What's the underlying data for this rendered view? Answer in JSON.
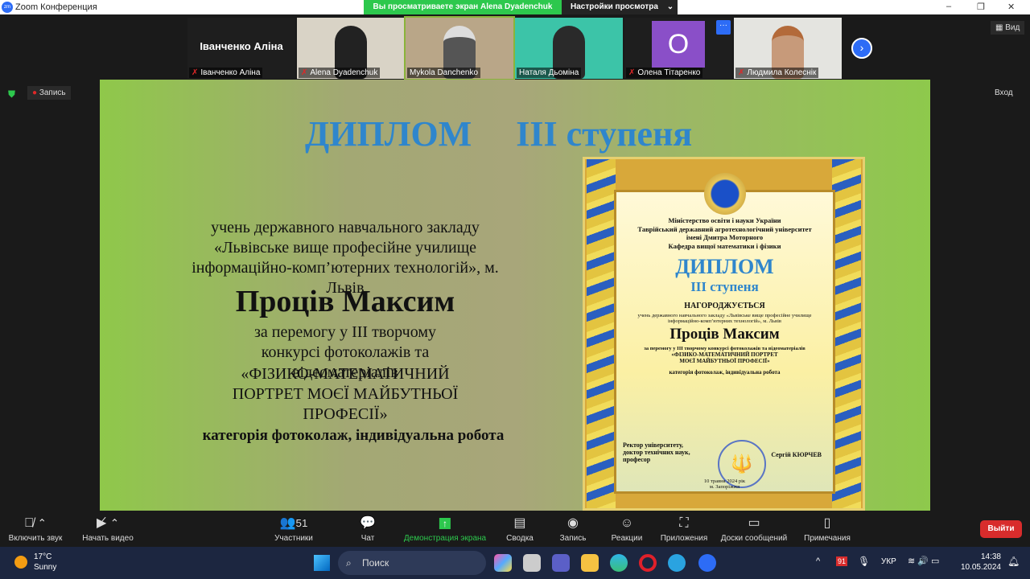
{
  "titlebar": {
    "title": "Zoom Конференция",
    "banner": "Вы просматриваете экран Alena Dyadenchuk",
    "view_settings": "Настройки просмотра"
  },
  "participants": [
    {
      "name": "Іванченко Аліна",
      "big_name": "Іванченко Аліна",
      "muted": true
    },
    {
      "name": "Alena Dyadenchuk",
      "muted": true
    },
    {
      "name": "Mykola Danchenko",
      "muted": false
    },
    {
      "name": "Наталя Дьоміна",
      "muted": false
    },
    {
      "name": "Олена Тітаренко",
      "muted": true,
      "initial": "О"
    },
    {
      "name": "Людмила Колеснік",
      "muted": true
    }
  ],
  "view_label": "Вид",
  "record_label": "Запись",
  "exit_top": "Вход",
  "slide": {
    "title": "ДИПЛОМ     ІІІ ступеня",
    "school": "учень державного навчального закладу «Львівське вище професійне училище інформаційно-комп’ютерних технологій», м. Львів",
    "name": "Проців Максим",
    "reason": "за перемогу у ІІІ творчому конкурсі фотоколажів та відеоматеріалів",
    "contest": "«ФІЗИКО-МАТЕМАТИЧНИЙ ПОРТРЕТ МОЄЇ МАЙБУТНЬОЇ ПРОФЕСІЇ»",
    "category": "категорія фотоколаж, індивідуальна робота"
  },
  "diploma": {
    "header": "Міністерство освіти і науки України\nТаврійський державний агротехнологічний університет\nімені Дмитра Моторного\nКафедра вищої математики і фізики",
    "title": "ДИПЛОМ",
    "degree": "ІІІ ступеня",
    "awarded": "НАГОРОДЖУЄТЬСЯ",
    "school": "учень державного навчального закладу «Львівське вище професійне училище інформаційно-комп’ютерних технологій», м. Львів",
    "name": "Проців Максим",
    "reason": "за перемогу у ІІІ творчому конкурсі фотоколажів та відеоматеріалів",
    "contest": "«ФІЗИКО-МАТЕМАТИЧНИЙ ПОРТРЕТ МОЄЇ МАЙБУТНЬОЇ ПРОФЕСІЇ»",
    "category": "категорія фотоколаж, індивідуальна робота",
    "signer_title": "Ректор університету,\nдоктор технічних наук,\nпрофесор",
    "signer": "Сергій КЮРЧЕВ",
    "date": "10 травня 2024 рік\nм. Запоріжжя"
  },
  "toolbar": {
    "unmute": "Включить звук",
    "video": "Начать видео",
    "participants": "Участники",
    "participants_count": "51",
    "chat": "Чат",
    "share": "Демонстрация экрана",
    "summary": "Сводка",
    "record": "Запись",
    "reactions": "Реакции",
    "apps": "Приложения",
    "whiteboards": "Доски сообщений",
    "notes": "Примечания",
    "leave": "Выйти"
  },
  "taskbar": {
    "temp": "17°C",
    "weather": "Sunny",
    "search": "Поиск",
    "lang": "УКР",
    "time": "14:38",
    "date": "10.05.2024",
    "badge": "91"
  }
}
